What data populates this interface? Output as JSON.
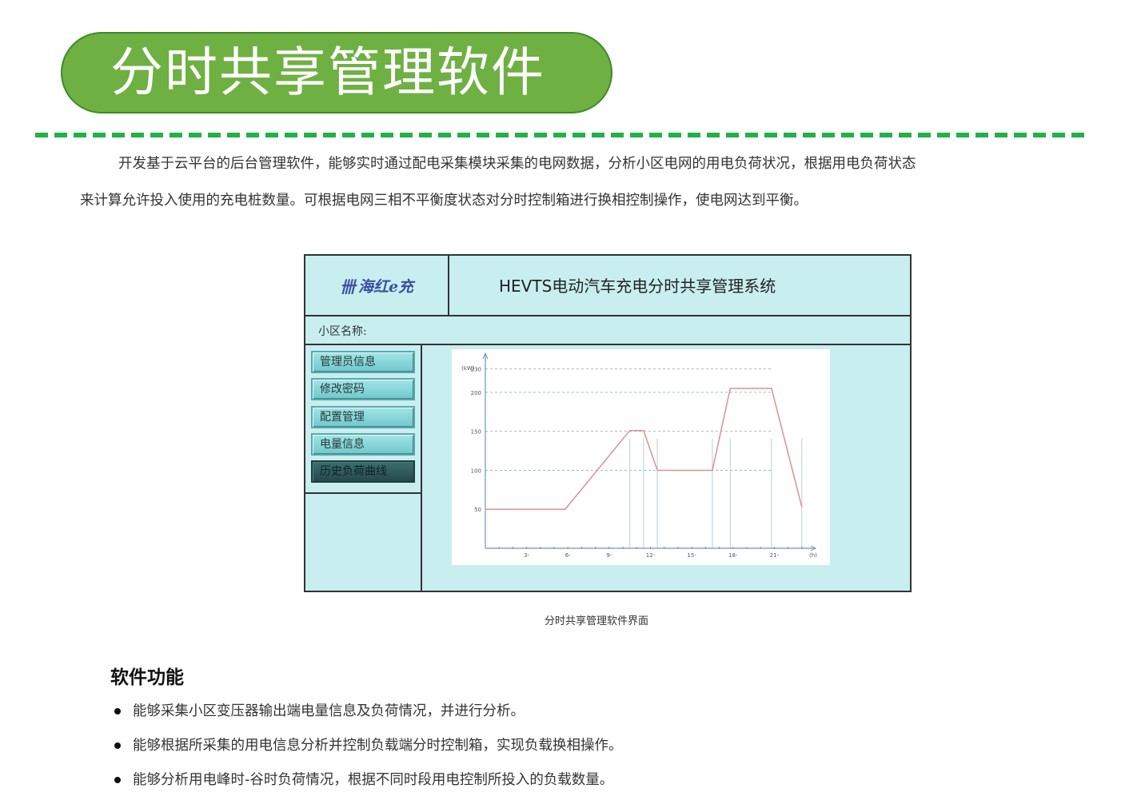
{
  "page": {
    "title": "分时共享管理软件",
    "intro_line1": "开发基于云平台的后台管理软件，能够实时通过配电采集模块采集的电网数据，分析小区电网的用电负荷状况，根据用电负荷状态",
    "intro_line2": "来计算允许投入使用的充电桩数量。可根据电网三相不平衡度状态对分时控制箱进行换相控制操作，使电网达到平衡。",
    "caption": "分时共享管理软件界面",
    "section_title": "软件功能",
    "bullets": [
      "能够采集小区变压器输出端电量信息及负荷情况，并进行分析。",
      "能够根据所采集的用电信息分析并控制负载端分时控制箱，实现负载换相操作。",
      "能够分析用电峰时-谷时负荷情况，根据不同时段用电控制所投入的负载数量。"
    ],
    "colors": {
      "title_green": "#6fb043",
      "dash_green": "#1fb24a",
      "app_bg": "#c8eef0",
      "curve": "#d9938f"
    }
  },
  "app": {
    "logo_text": "海红e充",
    "system_title": "HEVTS电动汽车充电分时共享管理系统",
    "community_label": "小区名称:",
    "menu": [
      "管理员信息",
      "修改密码",
      "配置管理",
      "电量信息",
      "历史负荷曲线"
    ],
    "active_menu": "历史负荷曲线"
  },
  "chart_data": {
    "type": "line",
    "ylabel": "(kW)",
    "xlabel": "(h)",
    "y_ticks": [
      "230",
      "200",
      "150",
      "100",
      "50"
    ],
    "x_ticks": [
      "3",
      "6",
      "9",
      "12",
      "15",
      "18",
      "21"
    ],
    "reference_lines": [
      230,
      200,
      150,
      100
    ],
    "xlim": [
      0,
      24
    ],
    "ylim": [
      0,
      245
    ],
    "series": [
      {
        "x": [
          0,
          5.8,
          10.5,
          11.5,
          12.5,
          16.5,
          17.8,
          20.8,
          23
        ],
        "y": [
          50,
          50,
          151,
          151,
          100,
          100,
          205,
          205,
          53
        ]
      }
    ],
    "drop_lines_x": [
      10.5,
      11.5,
      12.5,
      16.5,
      17.8,
      20.8,
      23
    ],
    "grid": false
  }
}
